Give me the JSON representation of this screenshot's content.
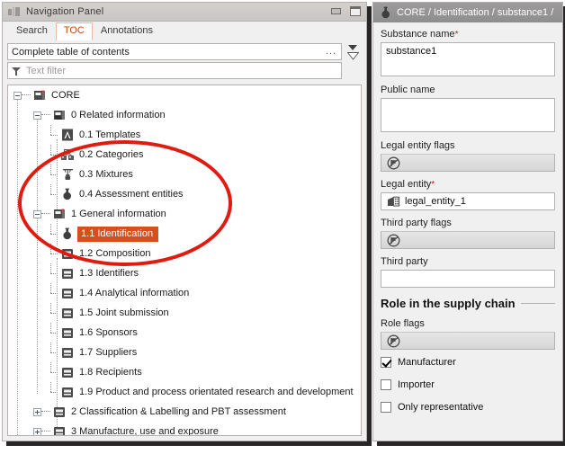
{
  "nav_window": {
    "title": "Navigation Panel",
    "icon": "panel-layout-icon",
    "minimize_label": "minimize-icon",
    "maximize_label": "maximize-icon",
    "tabs": [
      {
        "label": "Search",
        "active": false
      },
      {
        "label": "TOC",
        "active": true
      },
      {
        "label": "Annotations",
        "active": false
      }
    ],
    "toc_select": {
      "value": "Complete table of contents",
      "overflow": "...",
      "dropdown_icon": "chevron-down-icon",
      "expand_icon": "chevron-down-outline-icon"
    },
    "filter": {
      "icon": "filter-funnel-icon",
      "placeholder": "Text filter",
      "value": ""
    }
  },
  "tree": {
    "nodes": [
      {
        "id": "core",
        "label": "CORE",
        "depth": 0,
        "icon": "document-star-icon",
        "twisty": "minus",
        "selected": false
      },
      {
        "id": "n0",
        "label": "0 Related information",
        "depth": 1,
        "icon": "document-folder-icon",
        "twisty": "minus",
        "selected": false
      },
      {
        "id": "n0_1",
        "label": "0.1 Templates",
        "depth": 2,
        "icon": "template-a-icon",
        "twisty": "none",
        "selected": false
      },
      {
        "id": "n0_2",
        "label": "0.2 Categories",
        "depth": 2,
        "icon": "categories-icon",
        "twisty": "none",
        "selected": false
      },
      {
        "id": "n0_3",
        "label": "0.3 Mixtures",
        "depth": 2,
        "icon": "mixture-flask-icon",
        "twisty": "none",
        "selected": false
      },
      {
        "id": "n0_4",
        "label": "0.4 Assessment entities",
        "depth": 2,
        "icon": "flask-icon",
        "twisty": "none",
        "selected": false
      },
      {
        "id": "n1",
        "label": "1 General information",
        "depth": 1,
        "icon": "document-star-icon",
        "twisty": "minus",
        "selected": false
      },
      {
        "id": "n1_1",
        "label": "1.1 Identification",
        "depth": 2,
        "icon": "flask-icon",
        "twisty": "none",
        "selected": true
      },
      {
        "id": "n1_2",
        "label": "1.2 Composition",
        "depth": 2,
        "icon": "document-block-icon",
        "twisty": "none",
        "selected": false
      },
      {
        "id": "n1_3",
        "label": "1.3 Identifiers",
        "depth": 2,
        "icon": "document-block-icon",
        "twisty": "none",
        "selected": false
      },
      {
        "id": "n1_4",
        "label": "1.4 Analytical information",
        "depth": 2,
        "icon": "document-block-icon",
        "twisty": "none",
        "selected": false
      },
      {
        "id": "n1_5",
        "label": "1.5 Joint submission",
        "depth": 2,
        "icon": "document-block-icon",
        "twisty": "none",
        "selected": false
      },
      {
        "id": "n1_6",
        "label": "1.6 Sponsors",
        "depth": 2,
        "icon": "document-block-icon",
        "twisty": "none",
        "selected": false
      },
      {
        "id": "n1_7",
        "label": "1.7 Suppliers",
        "depth": 2,
        "icon": "document-block-icon",
        "twisty": "none",
        "selected": false
      },
      {
        "id": "n1_8",
        "label": "1.8 Recipients",
        "depth": 2,
        "icon": "document-block-icon",
        "twisty": "none",
        "selected": false
      },
      {
        "id": "n1_9",
        "label": "1.9 Product and process orientated research and development",
        "depth": 2,
        "icon": "document-block-icon",
        "twisty": "none",
        "selected": false
      },
      {
        "id": "n2",
        "label": "2 Classification & Labelling and PBT assessment",
        "depth": 1,
        "icon": "document-block-icon",
        "twisty": "plus",
        "selected": false
      },
      {
        "id": "n3",
        "label": "3 Manufacture, use and exposure",
        "depth": 1,
        "icon": "document-block-icon",
        "twisty": "plus",
        "selected": false
      }
    ],
    "selected_color": "#d74f1f"
  },
  "annotation": {
    "shape": "ellipse",
    "color": "#e01b10"
  },
  "detail": {
    "header": {
      "icon": "flask-icon",
      "breadcrumb": "CORE / Identification / substance1 /"
    },
    "fields": [
      {
        "name": "substance-name",
        "label": "Substance name",
        "required": true,
        "value": "substance1"
      },
      {
        "name": "public-name",
        "label": "Public name",
        "required": false,
        "value": ""
      }
    ],
    "legal_entity_flags": {
      "label": "Legal entity flags",
      "icon": "flag-disabled-icon"
    },
    "legal_entity": {
      "label": "Legal entity",
      "required": true,
      "value": "legal_entity_1",
      "icon": "building-icon"
    },
    "third_party_flags": {
      "label": "Third party flags",
      "icon": "flag-disabled-icon"
    },
    "third_party": {
      "label": "Third party",
      "required": false,
      "value": ""
    },
    "role_section": {
      "title": "Role in the supply chain",
      "role_flags_label": "Role flags",
      "role_flags_icon": "flag-disabled-icon",
      "checkboxes": [
        {
          "label": "Manufacturer",
          "checked": true
        },
        {
          "label": "Importer",
          "checked": false
        },
        {
          "label": "Only representative",
          "checked": false
        }
      ]
    }
  }
}
